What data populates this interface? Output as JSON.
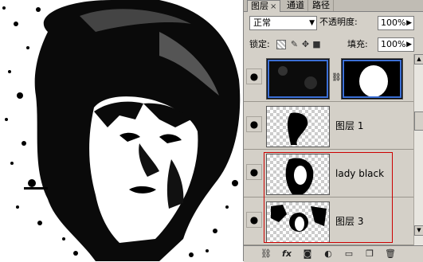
{
  "tabs": [
    {
      "label": "图层",
      "close": "×"
    },
    {
      "label": "通道"
    },
    {
      "label": "路径"
    }
  ],
  "blend_mode": "正常",
  "opacity_label": "不透明度:",
  "opacity_value": "100%",
  "lock_label": "锁定:",
  "fill_label": "填充:",
  "fill_value": "100%",
  "layers": [
    {
      "name": ""
    },
    {
      "name": "图层 1"
    },
    {
      "name": "lady black"
    },
    {
      "name": "图层 3"
    }
  ],
  "icons": {
    "eye": "eye-icon",
    "lock_transparent": "lock-transparent-icon",
    "lock_paint": "brush-icon",
    "lock_move": "move-icon",
    "lock_all": "lock-icon",
    "link": "link-icon",
    "fx": "fx-icon",
    "mask": "mask-icon",
    "adjust": "adjustment-icon",
    "group": "folder-icon",
    "new": "new-layer-icon",
    "trash": "trash-icon"
  },
  "accent": {
    "selection_border": "#cc0000",
    "panel_bg": "#d4d0c8"
  }
}
